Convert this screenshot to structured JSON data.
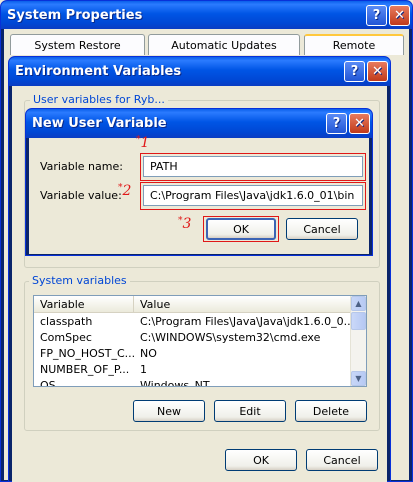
{
  "system_properties": {
    "title": "System Properties",
    "tabs": [
      {
        "label": "System Restore"
      },
      {
        "label": "Automatic Updates"
      },
      {
        "label": "Remote"
      }
    ],
    "help_glyph": "?",
    "close_glyph": "✕"
  },
  "env_vars": {
    "title": "Environment Variables",
    "user_vars_heading_partial": "User variables for Ryb...",
    "system_vars_label": "System variables",
    "columns": {
      "variable": "Variable",
      "value": "Value"
    },
    "rows": [
      {
        "variable": "classpath",
        "value": "C:\\Program Files\\Java\\Java\\jdk1.6.0_0..."
      },
      {
        "variable": "ComSpec",
        "value": "C:\\WINDOWS\\system32\\cmd.exe"
      },
      {
        "variable": "FP_NO_HOST_C...",
        "value": "NO"
      },
      {
        "variable": "NUMBER_OF_P...",
        "value": "1"
      },
      {
        "variable": "OS",
        "value": "Windows_NT"
      }
    ],
    "new_label": "New",
    "edit_label": "Edit",
    "delete_label": "Delete",
    "ok_label": "OK",
    "cancel_label": "Cancel"
  },
  "new_user_variable": {
    "title": "New User Variable",
    "name_label": "Variable name:",
    "name_value": "PATH",
    "value_label": "Variable value:",
    "value_value": "C:\\Program Files\\Java\\jdk1.6.0_01\\bin",
    "ok_label": "OK",
    "cancel_label": "Cancel"
  },
  "markers": {
    "m1": "1",
    "m2": "2",
    "m3": "3",
    "star": "*"
  },
  "colors": {
    "xp_titlebar": "#0055E5",
    "annotation_red": "#E01818",
    "group_label_blue": "#0046D5"
  }
}
